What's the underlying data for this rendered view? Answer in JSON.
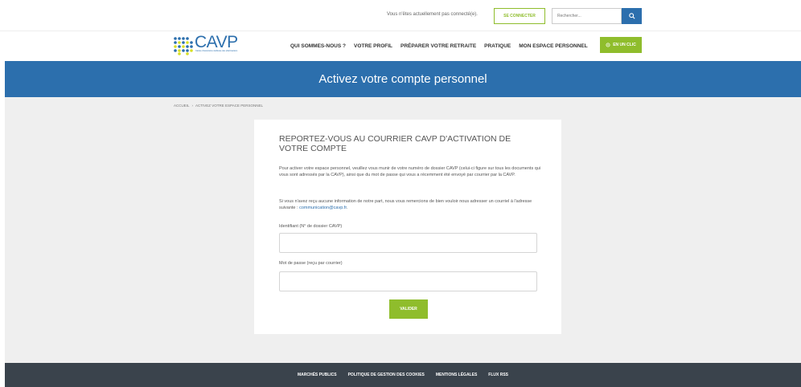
{
  "topbar": {
    "status_text": "Vous n'êtes actuellement pas connecté(e).",
    "login_label": "SE CONNECTER",
    "search_placeholder": "Rechercher...",
    "search_icon": "search-icon"
  },
  "logo": {
    "text": "CAVP",
    "tagline": "Caisse d'assurance vieillesse des pharmaciens"
  },
  "nav": {
    "items": [
      "QUI SOMMES-NOUS ?",
      "VOTRE PROFIL",
      "PRÉPARER VOTRE RETRAITE",
      "PRATIQUE",
      "MON ESPACE PERSONNEL"
    ],
    "cta_label": "EN UN CLIC",
    "cta_icon": "click-icon"
  },
  "banner": {
    "title": "Activez votre compte personnel"
  },
  "breadcrumb": {
    "home": "ACCUEIL",
    "separator": "›",
    "current": "ACTIVEZ VOTRE ESPACE PERSONNEL"
  },
  "card": {
    "title": "REPORTEZ-VOUS AU COURRIER CAVP D'ACTIVATION DE VOTRE COMPTE",
    "para1": "Pour activer votre espace personnel, veuillez vous munir de votre numéro de dossier CAVP (celui-ci figure sur tous les documents qui vous sont adressés par la CAVP), ainsi que du mot de passe qui vous a récemment été envoyé par courrier par la CAVP.",
    "para2_text": "Si vous n'avez reçu aucune information de notre part, nous vous remercions de bien vouloir nous adresser un courriel à l'adresse suivante : ",
    "para2_email": "communication@cavp.fr",
    "para2_end": ".",
    "field1_label": "Identifiant (N° de dossier CAVP)",
    "field1_value": "",
    "field2_label": "Mot de passe (reçu par courrier)",
    "field2_value": "",
    "submit_label": "VALIDER"
  },
  "footer": {
    "links": [
      "MARCHÉS PUBLICS",
      "POLITIQUE DE GESTION DES COOKIES",
      "MENTIONS LÉGALES",
      "FLUX RSS"
    ]
  },
  "colors": {
    "brand_blue": "#2c6fad",
    "accent_green": "#8fbd2c",
    "footer_bg": "#3a434c"
  }
}
